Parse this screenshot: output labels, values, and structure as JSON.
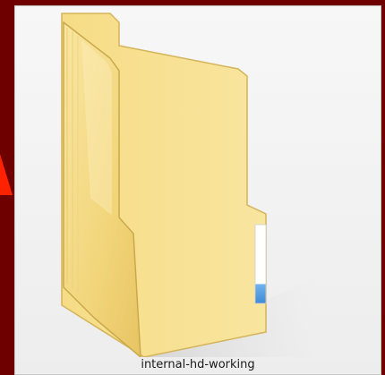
{
  "item": {
    "label": "internal-hd-working",
    "icon": "folder-icon"
  },
  "colors": {
    "background": "#6e0000",
    "arrow": "#ff2200",
    "tile": "#f2f2f2",
    "folder_light": "#fbe9a3",
    "folder_mid": "#f3d77c",
    "folder_dark": "#d9b95a",
    "paper_accent": "#5aa0e6"
  }
}
